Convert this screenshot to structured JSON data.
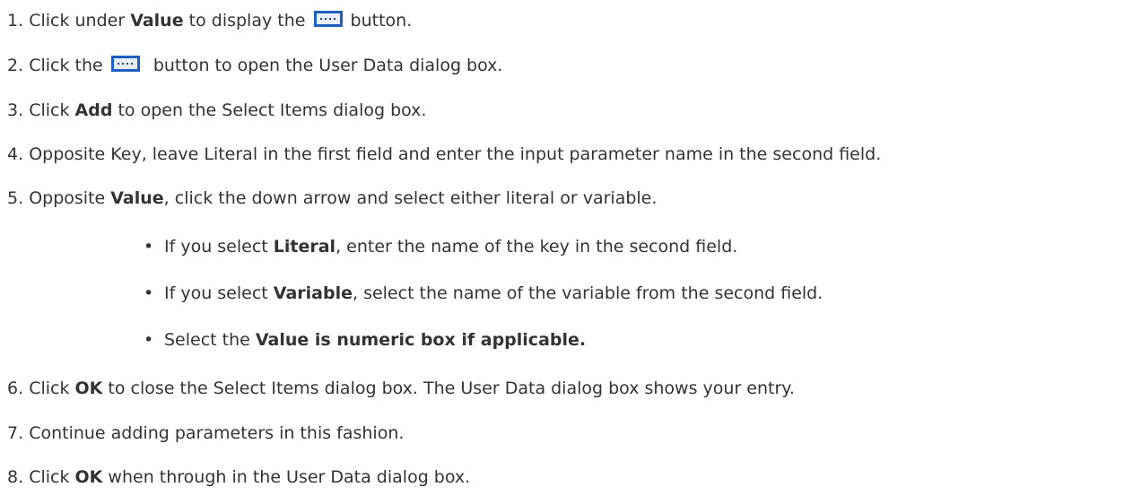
{
  "steps": [
    {
      "num": "1.",
      "pre": "Click under ",
      "bold": "Value",
      "mid": " to display the ",
      "post": " button."
    },
    {
      "num": "2.",
      "pre": "Click the ",
      "post": "  button to open the User Data dialog box."
    },
    {
      "num": "3.",
      "pre": "Click ",
      "bold": "Add",
      "post": " to open the Select Items dialog box."
    },
    {
      "num": "4.",
      "text": "Opposite Key, leave Literal in the first field and enter the input parameter name in the second field."
    },
    {
      "num": "5.",
      "pre": "Opposite ",
      "bold": "Value",
      "post": ", click the down arrow and select either literal or variable."
    },
    {
      "num": "6.",
      "pre": "Click ",
      "bold": "OK",
      "post": " to close the Select Items dialog box. The User Data dialog box shows your entry."
    },
    {
      "num": "7.",
      "text": "Continue adding parameters in this fashion."
    },
    {
      "num": "8.",
      "pre": "Click ",
      "bold": "OK",
      "post": " when through in the User Data dialog box."
    }
  ],
  "bullets": [
    {
      "dot": "•",
      "pre": "If you select ",
      "bold": "Literal",
      "post": ", enter the name of the key in the second field."
    },
    {
      "dot": "•",
      "pre": "If you select ",
      "bold": "Variable",
      "post": ", select the name of the variable from the second field."
    },
    {
      "dot": "•",
      "pre": "Select the ",
      "bold": "Value is numeric box if applicable.",
      "post": ""
    }
  ],
  "icons": {
    "ellipsis_button": "ellipsis-button-icon"
  },
  "colors": {
    "text": "#333333",
    "icon_blue": "#1f5fbf",
    "icon_face": "#e8eef7"
  }
}
